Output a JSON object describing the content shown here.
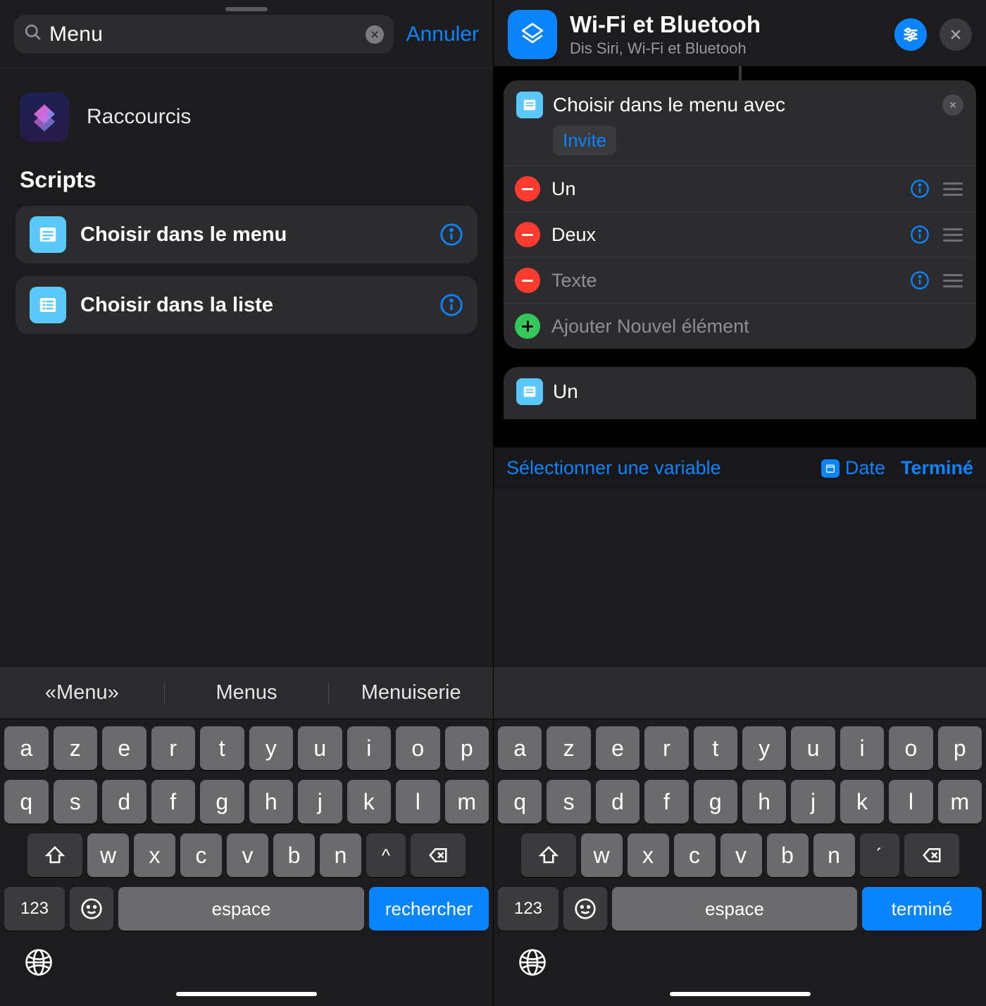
{
  "left": {
    "search": {
      "value": "Menu",
      "cancel": "Annuler"
    },
    "app": {
      "name": "Raccourcis"
    },
    "section_title": "Scripts",
    "actions": [
      {
        "label": "Choisir dans le menu"
      },
      {
        "label": "Choisir dans la liste"
      }
    ],
    "suggestions": [
      "«Menu»",
      "Menus",
      "Menuiserie"
    ],
    "keyboard": {
      "row1": [
        "a",
        "z",
        "e",
        "r",
        "t",
        "y",
        "u",
        "i",
        "o",
        "p"
      ],
      "row2": [
        "q",
        "s",
        "d",
        "f",
        "g",
        "h",
        "j",
        "k",
        "l",
        "m"
      ],
      "row3": [
        "w",
        "x",
        "c",
        "v",
        "b",
        "n"
      ],
      "carat": "^",
      "num": "123",
      "space": "espace",
      "action": "rechercher"
    }
  },
  "right": {
    "header": {
      "title": "Wi-Fi et Bluetooh",
      "subtitle": "Dis Siri, Wi-Fi et Bluetooh"
    },
    "card": {
      "title": "Choisir dans le menu avec",
      "token": "Invite",
      "rows": [
        {
          "label": "Un",
          "placeholder": false
        },
        {
          "label": "Deux",
          "placeholder": false
        },
        {
          "label": "Texte",
          "placeholder": true
        }
      ],
      "add": "Ajouter Nouvel élément"
    },
    "card2": {
      "label": "Un"
    },
    "toolbar": {
      "select_var": "Sélectionner une variable",
      "date": "Date",
      "done": "Terminé"
    },
    "keyboard": {
      "row1": [
        "a",
        "z",
        "e",
        "r",
        "t",
        "y",
        "u",
        "i",
        "o",
        "p"
      ],
      "row2": [
        "q",
        "s",
        "d",
        "f",
        "g",
        "h",
        "j",
        "k",
        "l",
        "m"
      ],
      "row3": [
        "w",
        "x",
        "c",
        "v",
        "b",
        "n"
      ],
      "carat": "´",
      "num": "123",
      "space": "espace",
      "action": "terminé"
    }
  }
}
